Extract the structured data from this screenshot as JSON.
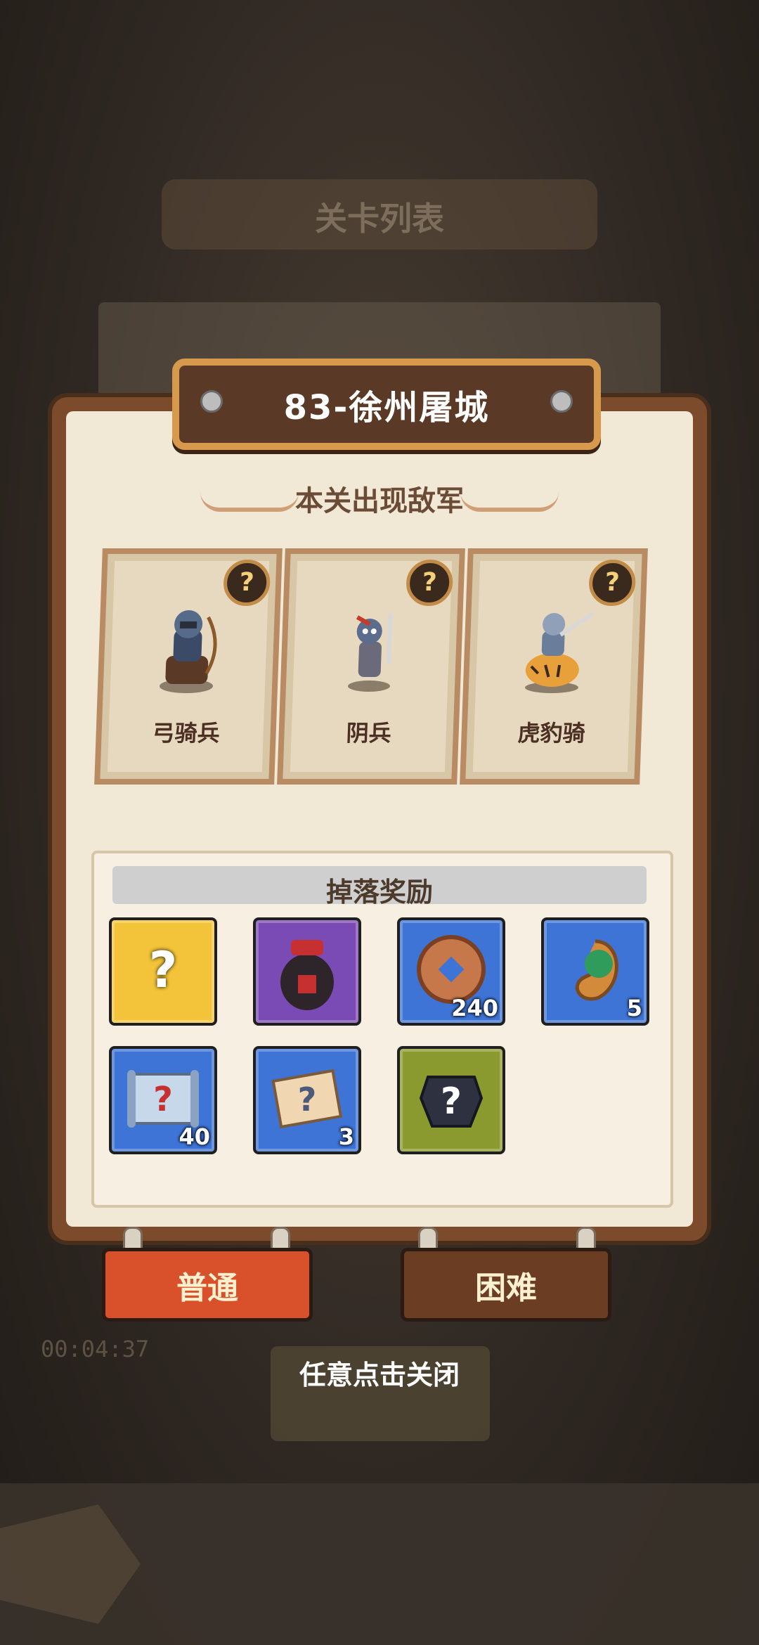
{
  "background": {
    "title": "关卡列表",
    "timer": "00:04:37"
  },
  "level": {
    "title": "83-徐州屠城"
  },
  "enemies": {
    "section_title": "本关出现敌军",
    "items": [
      {
        "name": "弓骑兵",
        "help_icon": "?"
      },
      {
        "name": "阴兵",
        "help_icon": "?"
      },
      {
        "name": "虎豹骑",
        "help_icon": "?"
      }
    ]
  },
  "rewards": {
    "section_title": "掉落奖励",
    "items": [
      {
        "icon": "chest-icon",
        "count": "",
        "color": "#f3c43a"
      },
      {
        "icon": "wine-jar-icon",
        "count": "",
        "color": "#7b4bb5"
      },
      {
        "icon": "coin-icon",
        "count": "240",
        "color": "#3e74d6"
      },
      {
        "icon": "jade-icon",
        "count": "5",
        "color": "#3e74d6"
      },
      {
        "icon": "scroll-blue-icon",
        "count": "40",
        "color": "#3e74d6"
      },
      {
        "icon": "scroll-tan-icon",
        "count": "3",
        "color": "#3e74d6"
      },
      {
        "icon": "armor-icon",
        "count": "",
        "color": "#8b9a2e"
      }
    ]
  },
  "tabs": {
    "normal": "普通",
    "hard": "困难"
  },
  "hint": "任意点击关闭",
  "colors": {
    "panel_wood": "#7b4b2c",
    "panel_paper": "#f2e8d6",
    "tab_normal": "#d9512b",
    "tab_hard": "#6b3e24"
  }
}
